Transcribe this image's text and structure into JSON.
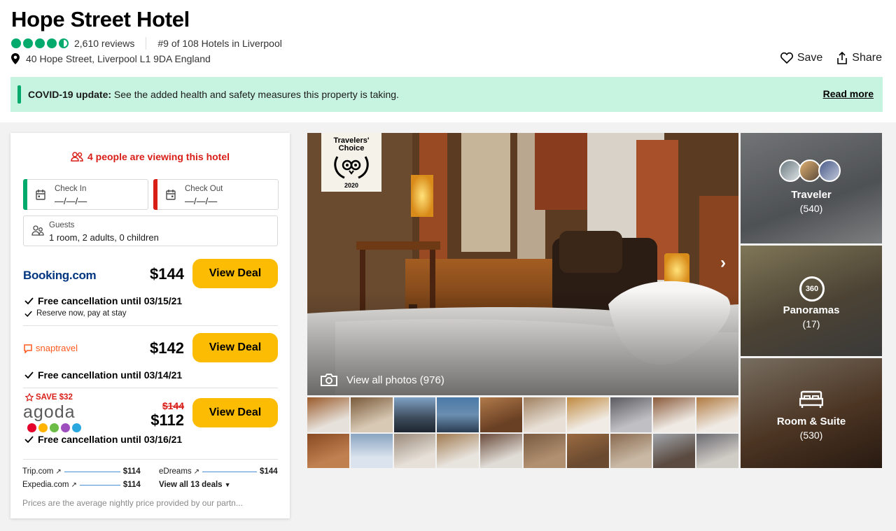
{
  "hotel": {
    "name": "Hope Street Hotel",
    "reviews": "2,610 reviews",
    "ranking": "#9 of 108 Hotels in Liverpool",
    "address": "40 Hope Street, Liverpool L1 9DA England",
    "rating": 4.5
  },
  "actions": {
    "save": "Save",
    "share": "Share"
  },
  "covid": {
    "label": "COVID-19 update:",
    "text": " See the added health and safety measures this property is taking.",
    "read_more": "Read more"
  },
  "booking": {
    "viewing": "4 people are viewing this hotel",
    "check_in_label": "Check In",
    "check_in_value": "—/—/—",
    "check_out_label": "Check Out",
    "check_out_value": "—/—/—",
    "guests_label": "Guests",
    "guests_value": "1 room, 2 adults, 0 children"
  },
  "offers": [
    {
      "provider": "Booking.com",
      "price": "$144",
      "button": "View Deal",
      "note1": "Free cancellation until 03/15/21",
      "note2": "Reserve now, pay at stay"
    },
    {
      "provider": "snaptravel",
      "price": "$142",
      "button": "View Deal",
      "note1": "Free cancellation until 03/14/21"
    },
    {
      "provider": "agoda",
      "save_badge": "SAVE $32",
      "old_price": "$144",
      "price": "$112",
      "button": "View Deal",
      "note1": "Free cancellation until 03/16/21"
    }
  ],
  "more_deals": {
    "trip": {
      "name": "Trip.com",
      "price": "$114"
    },
    "edreams": {
      "name": "eDreams",
      "price": "$144"
    },
    "expedia": {
      "name": "Expedia.com",
      "price": "$114"
    },
    "view_all": "View all 13 deals"
  },
  "disclaimer": "Prices are the average nightly price provided by our partn...",
  "photos": {
    "badge_title": "Travelers' Choice",
    "badge_year": "2020",
    "view_all": "View all photos",
    "count": "(976)"
  },
  "side_tiles": [
    {
      "label": "Traveler",
      "count": "(540)"
    },
    {
      "label": "Panoramas",
      "count": "(17)",
      "icon_text": "360"
    },
    {
      "label": "Room & Suite",
      "count": "(530)"
    }
  ],
  "colors": {
    "accent_green": "#00aa6c",
    "covid_bg": "#c7f4e0",
    "deal_button": "#fcbc04",
    "alert_red": "#d91e18",
    "booking_blue": "#003580",
    "snaptravel_orange": "#ff5a1f"
  },
  "icons": [
    "map-pin-icon",
    "heart-icon",
    "share-icon",
    "people-icon",
    "calendar-icon",
    "guests-icon",
    "check-icon",
    "camera-icon",
    "chevron-right-icon",
    "bed-icon",
    "360-icon",
    "external-link-icon",
    "star-icon"
  ]
}
